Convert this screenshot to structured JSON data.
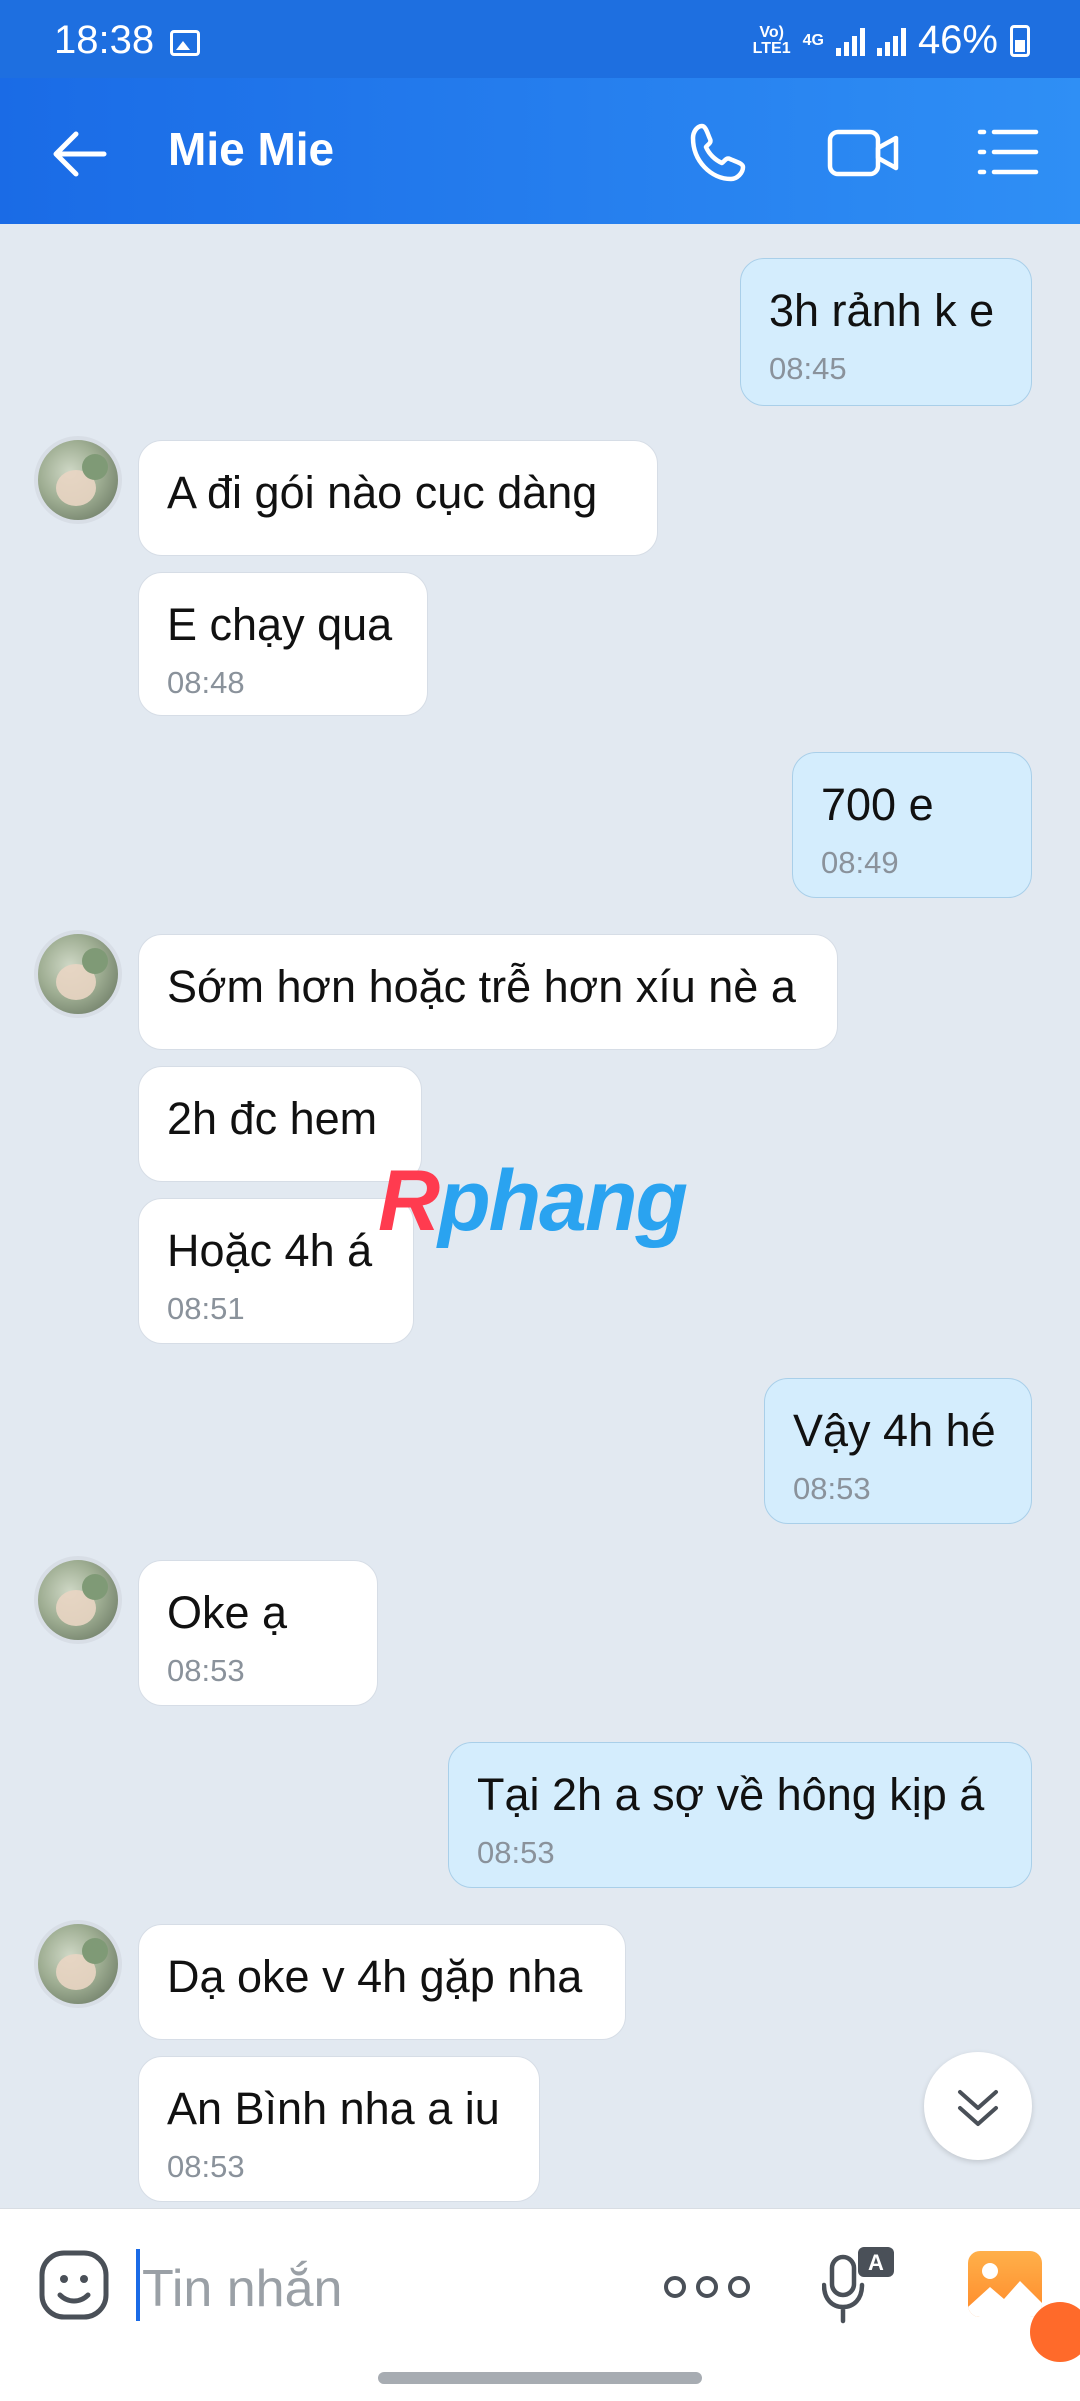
{
  "status_bar": {
    "time": "18:38",
    "network_top": "Vo)\nLTE1",
    "network_tag": "4G",
    "battery": "46%"
  },
  "header": {
    "title": "Mie Mie",
    "icons": [
      "back-arrow-icon",
      "phone-icon",
      "video-call-icon",
      "menu-list-icon"
    ]
  },
  "messages": [
    {
      "dir": "out",
      "text": "3h rảnh k e",
      "time": "08:45"
    },
    {
      "dir": "in",
      "text": "A đi gói nào cục dàng",
      "time": ""
    },
    {
      "dir": "in",
      "text": "E chạy qua",
      "time": "08:48"
    },
    {
      "dir": "out",
      "text": "700 e",
      "time": "08:49"
    },
    {
      "dir": "in",
      "text": "Sớm hơn hoặc trễ hơn xíu nè a",
      "time": ""
    },
    {
      "dir": "in",
      "text": "2h đc hem",
      "time": ""
    },
    {
      "dir": "in",
      "text": "Hoặc 4h á",
      "time": "08:51"
    },
    {
      "dir": "out",
      "text": "Vậy 4h hé",
      "time": "08:53"
    },
    {
      "dir": "in",
      "text": "Oke ạ",
      "time": "08:53"
    },
    {
      "dir": "out",
      "text": "Tại 2h a sợ về hông kịp á",
      "time": "08:53"
    },
    {
      "dir": "in",
      "text": "Dạ oke v 4h gặp nha",
      "time": ""
    },
    {
      "dir": "in",
      "text": "An Bình nha a iu",
      "time": "08:53"
    }
  ],
  "watermark": {
    "part1": "R",
    "part2": "phang"
  },
  "composer": {
    "placeholder": "Tin nhắn"
  },
  "colors": {
    "header": "#1e6fe0",
    "chat_bg": "#e2e9f1",
    "outgoing_bubble": "#d4edfd",
    "incoming_bubble": "#ffffff",
    "accent": "#1a6be6"
  }
}
